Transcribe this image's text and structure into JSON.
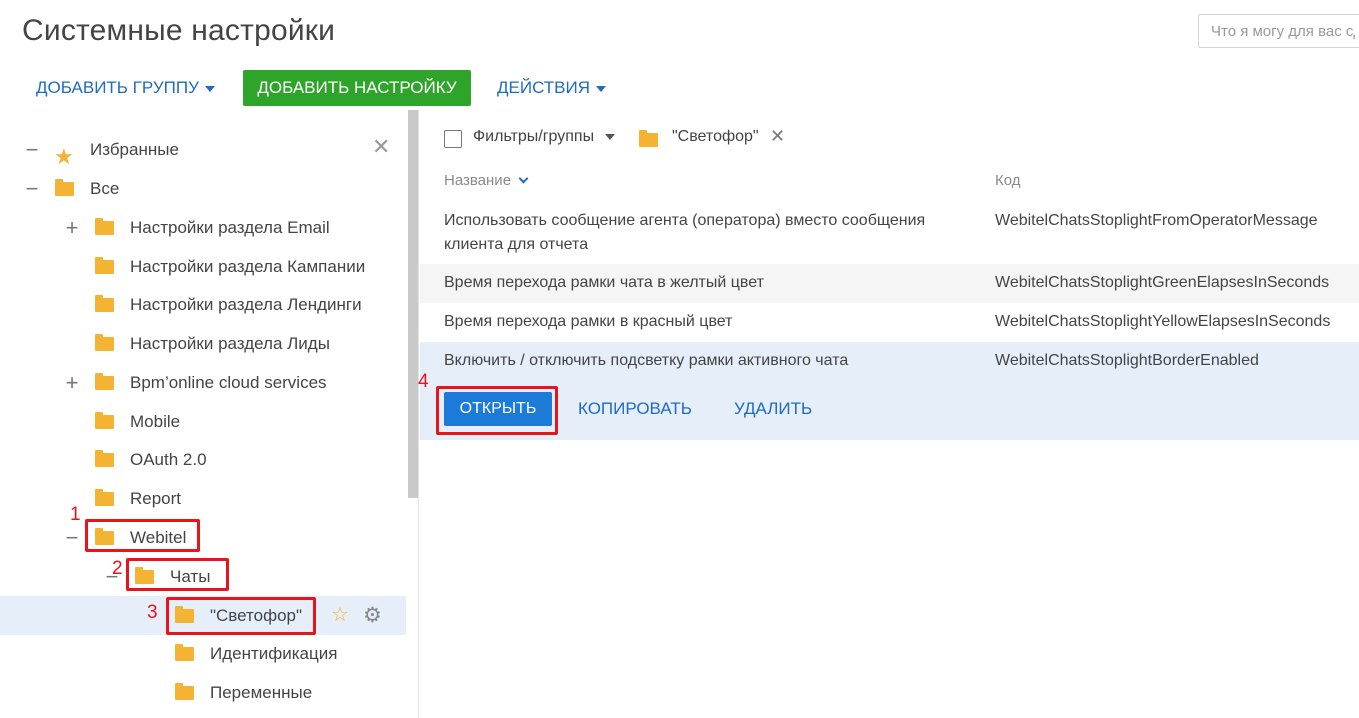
{
  "header": {
    "title": "Системные настройки",
    "search_placeholder": "Что я могу для вас сделать?"
  },
  "toolbar": {
    "add_group": "ДОБАВИТЬ ГРУППУ",
    "add_setting": "ДОБАВИТЬ НАСТРОЙКУ",
    "actions": "ДЕЙСТВИЯ"
  },
  "tree": {
    "favorites": "Избранные",
    "all": "Все",
    "items": [
      {
        "label": "Настройки раздела Email",
        "toggle": "+"
      },
      {
        "label": "Настройки раздела Кампании",
        "toggle": ""
      },
      {
        "label": "Настройки раздела Лендинги",
        "toggle": ""
      },
      {
        "label": "Настройки раздела Лиды",
        "toggle": ""
      },
      {
        "label": "Bpm’online cloud services",
        "toggle": "+"
      },
      {
        "label": "Mobile",
        "toggle": ""
      },
      {
        "label": "OAuth 2.0",
        "toggle": ""
      },
      {
        "label": "Report",
        "toggle": ""
      },
      {
        "label": "Webitel",
        "toggle": "−"
      },
      {
        "label": "Чаты",
        "toggle": "−"
      },
      {
        "label": "\"Светофор\"",
        "toggle": ""
      },
      {
        "label": "Идентификация",
        "toggle": ""
      },
      {
        "label": "Переменные",
        "toggle": ""
      }
    ]
  },
  "filter": {
    "label": "Фильтры/группы",
    "group": "\"Светофор\""
  },
  "table": {
    "columns": [
      "Название",
      "Код"
    ],
    "rows": [
      {
        "name": "Использовать сообщение агента (оператора) вместо сообщения клиента для отчета",
        "code": "WebitelChatsStoplightFromOperatorMessage"
      },
      {
        "name": "Время перехода рамки чата в желтый цвет",
        "code": "WebitelChatsStoplightGreenElapsesInSeconds"
      },
      {
        "name": "Время перехода рамки в красный цвет",
        "code": "WebitelChatsStoplightYellowElapsesInSeconds"
      },
      {
        "name": "Включить / отключить подсветку рамки активного чата",
        "code": "WebitelChatsStoplightBorderEnabled"
      }
    ]
  },
  "row_actions": {
    "open": "ОТКРЫТЬ",
    "copy": "КОПИРОВАТЬ",
    "delete": "УДАЛИТЬ"
  },
  "annotations": [
    "1",
    "2",
    "3",
    "4"
  ],
  "colors": {
    "accent": "#1f6bc2",
    "green": "#2ea52a",
    "open_button": "#1c7ad8",
    "folder": "#f5b333",
    "highlight": "#e8141c",
    "selected_row": "#e6eefa"
  }
}
